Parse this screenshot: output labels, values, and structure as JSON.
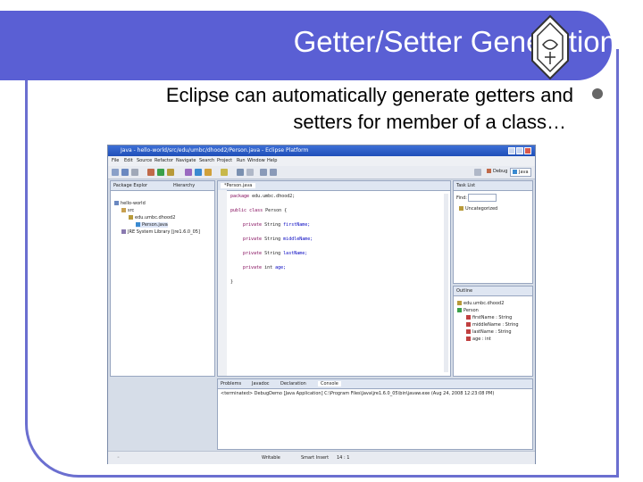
{
  "slide": {
    "title": "Getter/Setter Generation",
    "bullet_line1": "Eclipse can automatically generate getters and",
    "bullet_line2": "setters for member of a class…"
  },
  "eclipse": {
    "window_title": "Java - hello-world/src/edu/umbc/dhood2/Person.java - Eclipse Platform",
    "menu": [
      "File",
      "Edit",
      "Source",
      "Refactor",
      "Navigate",
      "Search",
      "Project",
      "Run",
      "Window",
      "Help"
    ],
    "perspectives": {
      "debug": "Debug",
      "java": "Java"
    },
    "package_explorer": {
      "tab": "Package Explor",
      "tab2": "Hierarchy",
      "tree": [
        "hello-world",
        "src",
        "edu.umbc.dhood2",
        "Person.java",
        "JRE System Library [jre1.6.0_05]"
      ]
    },
    "editor": {
      "tab": "*Person.java",
      "lines": [
        {
          "kw": "package",
          "rest": " edu.umbc.dhood2;"
        },
        {
          "kw": "public class",
          "rest": " Person {"
        },
        {
          "kw": "private",
          "rest": " String ",
          "field": "firstName;"
        },
        {
          "kw": "private",
          "rest": " String ",
          "field": "middleName;"
        },
        {
          "kw": "private",
          "rest": " String ",
          "field": "lastName;"
        },
        {
          "kw": "private",
          "rest": " int ",
          "field": "age;"
        },
        {
          "kw": "",
          "rest": "}"
        }
      ]
    },
    "task_list": {
      "tab": "Task List",
      "find_label": "Find:",
      "item": "Uncategorized"
    },
    "outline": {
      "tab": "Outline",
      "tree": [
        "edu.umbc.dhood2",
        "Person",
        "firstName : String",
        "middleName : String",
        "lastName : String",
        "age : int"
      ]
    },
    "bottom": {
      "tabs": [
        "Problems",
        "Javadoc",
        "Declaration",
        "Console"
      ],
      "console_text": "<terminated> DebugDemo [Java Application] C:\\Program Files\\Java\\jre1.6.0_05\\bin\\javaw.exe (Aug 24, 2008 12:23:08 PM)"
    },
    "status": {
      "mode": "Writable",
      "insert": "Smart Insert",
      "position": "14 : 1"
    }
  }
}
